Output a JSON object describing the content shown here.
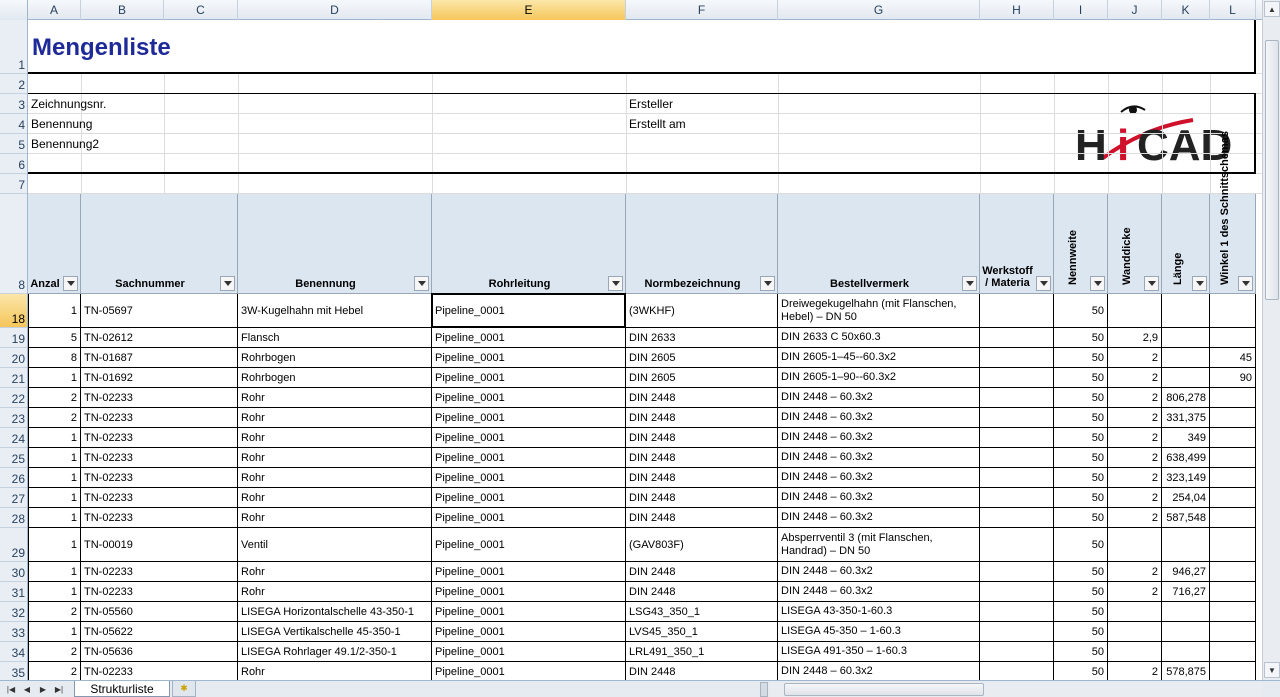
{
  "columns": [
    "A",
    "B",
    "C",
    "D",
    "E",
    "F",
    "G",
    "H",
    "I",
    "J",
    "K",
    "L"
  ],
  "selected_column": "E",
  "title": "Mengenliste",
  "info": {
    "zeichnungsnr": "Zeichnungsnr.",
    "benennung": "Benennung",
    "benennung2": "Benennung2",
    "ersteller": "Ersteller",
    "erstellt_am": "Erstellt am"
  },
  "logo_text": "HiCAD",
  "headers": {
    "anzahl": "Anzal",
    "sachnummer": "Sachnummer",
    "benennung": "Benennung",
    "rohrleitung": "Rohrleitung",
    "normbezeichnung": "Normbezeichnung",
    "bestellvermerk": "Bestellvermerk",
    "werkstoff_1": "Werkstoff",
    "werkstoff_2": "/ Materia",
    "nennweite": "Nennweite",
    "wanddicke": "Wanddicke",
    "laenge": "Länge",
    "winkel": "Winkel 1 des Schnittschemas"
  },
  "row_numbers_top": [
    "1",
    "2",
    "3",
    "4",
    "5",
    "6",
    "7",
    "8"
  ],
  "rows": [
    {
      "rn": "18",
      "a": "1",
      "b": "TN-05697",
      "d": "3W-Kugelhahn mit Hebel",
      "e": "Pipeline_0001",
      "f": "(3WKHF)",
      "g": "Dreiwegekugelhahn (mit Flanschen, Hebel) – DN 50",
      "i": "50",
      "j": "",
      "k": "",
      "l": ""
    },
    {
      "rn": "19",
      "a": "5",
      "b": "TN-02612",
      "d": "Flansch",
      "e": "Pipeline_0001",
      "f": "DIN 2633",
      "g": "DIN 2633 C 50x60.3",
      "i": "50",
      "j": "2,9",
      "k": "",
      "l": ""
    },
    {
      "rn": "20",
      "a": "8",
      "b": "TN-01687",
      "d": "Rohrbogen",
      "e": "Pipeline_0001",
      "f": "DIN 2605",
      "g": "DIN 2605-1–45--60.3x2",
      "i": "50",
      "j": "2",
      "k": "",
      "l": "45"
    },
    {
      "rn": "21",
      "a": "1",
      "b": "TN-01692",
      "d": "Rohrbogen",
      "e": "Pipeline_0001",
      "f": "DIN 2605",
      "g": "DIN 2605-1–90--60.3x2",
      "i": "50",
      "j": "2",
      "k": "",
      "l": "90"
    },
    {
      "rn": "22",
      "a": "2",
      "b": "TN-02233",
      "d": "Rohr",
      "e": "Pipeline_0001",
      "f": "DIN 2448",
      "g": "DIN 2448 – 60.3x2",
      "i": "50",
      "j": "2",
      "k": "806,278",
      "l": ""
    },
    {
      "rn": "23",
      "a": "2",
      "b": "TN-02233",
      "d": "Rohr",
      "e": "Pipeline_0001",
      "f": "DIN 2448",
      "g": "DIN 2448 – 60.3x2",
      "i": "50",
      "j": "2",
      "k": "331,375",
      "l": ""
    },
    {
      "rn": "24",
      "a": "1",
      "b": "TN-02233",
      "d": "Rohr",
      "e": "Pipeline_0001",
      "f": "DIN 2448",
      "g": "DIN 2448 – 60.3x2",
      "i": "50",
      "j": "2",
      "k": "349",
      "l": ""
    },
    {
      "rn": "25",
      "a": "1",
      "b": "TN-02233",
      "d": "Rohr",
      "e": "Pipeline_0001",
      "f": "DIN 2448",
      "g": "DIN 2448 – 60.3x2",
      "i": "50",
      "j": "2",
      "k": "638,499",
      "l": ""
    },
    {
      "rn": "26",
      "a": "1",
      "b": "TN-02233",
      "d": "Rohr",
      "e": "Pipeline_0001",
      "f": "DIN 2448",
      "g": "DIN 2448 – 60.3x2",
      "i": "50",
      "j": "2",
      "k": "323,149",
      "l": ""
    },
    {
      "rn": "27",
      "a": "1",
      "b": "TN-02233",
      "d": "Rohr",
      "e": "Pipeline_0001",
      "f": "DIN 2448",
      "g": "DIN 2448 – 60.3x2",
      "i": "50",
      "j": "2",
      "k": "254,04",
      "l": ""
    },
    {
      "rn": "28",
      "a": "1",
      "b": "TN-02233",
      "d": "Rohr",
      "e": "Pipeline_0001",
      "f": "DIN 2448",
      "g": "DIN 2448 – 60.3x2",
      "i": "50",
      "j": "2",
      "k": "587,548",
      "l": ""
    },
    {
      "rn": "29",
      "a": "1",
      "b": "TN-00019",
      "d": "Ventil",
      "e": "Pipeline_0001",
      "f": "(GAV803F)",
      "g": "Absperrventil 3 (mit Flanschen, Handrad) – DN 50",
      "i": "50",
      "j": "",
      "k": "",
      "l": ""
    },
    {
      "rn": "30",
      "a": "1",
      "b": "TN-02233",
      "d": "Rohr",
      "e": "Pipeline_0001",
      "f": "DIN 2448",
      "g": "DIN 2448 – 60.3x2",
      "i": "50",
      "j": "2",
      "k": "946,27",
      "l": ""
    },
    {
      "rn": "31",
      "a": "1",
      "b": "TN-02233",
      "d": "Rohr",
      "e": "Pipeline_0001",
      "f": "DIN 2448",
      "g": "DIN 2448 – 60.3x2",
      "i": "50",
      "j": "2",
      "k": "716,27",
      "l": ""
    },
    {
      "rn": "32",
      "a": "2",
      "b": "TN-05560",
      "d": "LISEGA Horizontalschelle 43-350-1",
      "e": "Pipeline_0001",
      "f": "LSG43_350_1",
      "g": "LISEGA 43-350-1-60.3",
      "i": "50",
      "j": "",
      "k": "",
      "l": ""
    },
    {
      "rn": "33",
      "a": "1",
      "b": "TN-05622",
      "d": "LISEGA Vertikalschelle 45-350-1",
      "e": "Pipeline_0001",
      "f": "LVS45_350_1",
      "g": "LISEGA 45-350 – 1-60.3",
      "i": "50",
      "j": "",
      "k": "",
      "l": ""
    },
    {
      "rn": "34",
      "a": "2",
      "b": "TN-05636",
      "d": "LISEGA Rohrlager 49.1/2-350-1",
      "e": "Pipeline_0001",
      "f": "LRL491_350_1",
      "g": "LISEGA 491-350 – 1-60.3",
      "i": "50",
      "j": "",
      "k": "",
      "l": ""
    },
    {
      "rn": "35",
      "a": "2",
      "b": "TN-02233",
      "d": "Rohr",
      "e": "Pipeline_0001",
      "f": "DIN 2448",
      "g": "DIN 2448 – 60.3x2",
      "i": "50",
      "j": "2",
      "k": "578,875",
      "l": ""
    }
  ],
  "sheet_tab": "Strukturliste"
}
